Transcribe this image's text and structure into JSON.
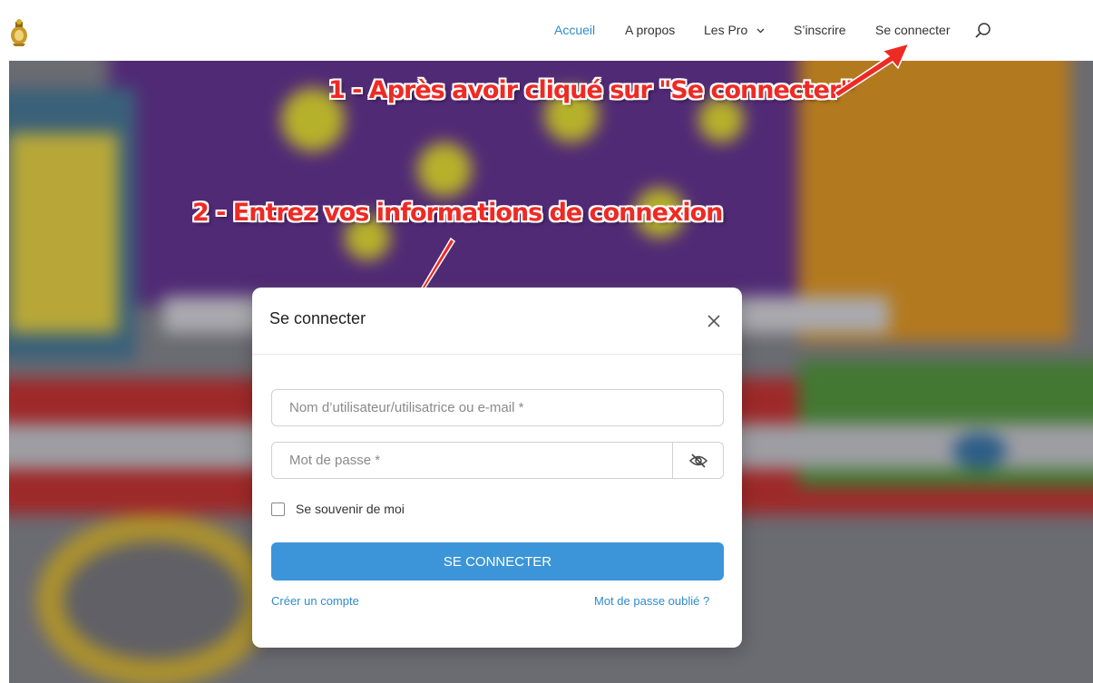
{
  "nav": {
    "items": [
      {
        "label": "Accueil",
        "active": true
      },
      {
        "label": "A propos",
        "active": false
      },
      {
        "label": "Les Pro",
        "active": false,
        "has_dropdown": true
      },
      {
        "label": "S’inscrire",
        "active": false
      },
      {
        "label": "Se connecter",
        "active": false
      }
    ],
    "search_icon": "search-icon"
  },
  "annotations": {
    "step1": "1 - Après avoir cliqué sur \"Se connecter\"",
    "step2": "2 - Entrez vos informations de connexion"
  },
  "modal": {
    "title": "Se connecter",
    "username_placeholder": "Nom d’utilisateur/utilisatrice ou e-mail *",
    "username_value": "",
    "password_placeholder": "Mot de passe *",
    "password_value": "",
    "remember_label": "Se souvenir de moi",
    "remember_checked": false,
    "submit_label": "SE CONNECTER",
    "create_account": "Créer un compte",
    "lost_password": "Mot de passe oublié ?"
  },
  "colors": {
    "accent": "#2f8ccd",
    "button": "#3b95d8",
    "annotation": "#ee2a24"
  }
}
